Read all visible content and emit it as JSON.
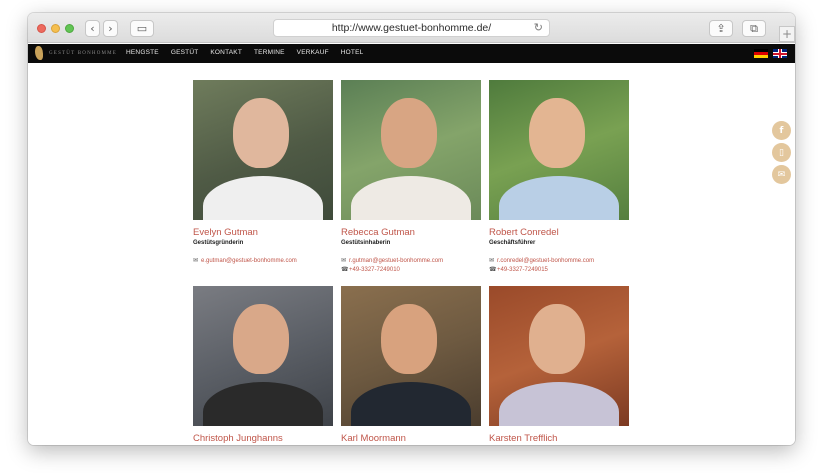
{
  "browser": {
    "url": "http://www.gestuet-bonhomme.de/",
    "back_icon": "‹",
    "forward_icon": "›",
    "sidebar_icon": "▭",
    "reload_icon": "↻",
    "share_icon": "⇪",
    "tabs_icon": "⧉",
    "new_tab_icon": "+"
  },
  "site": {
    "logo_text": "GESTÜT BONHOMME",
    "nav": [
      "HENGSTE",
      "GESTÜT",
      "KONTAKT",
      "TERMINE",
      "VERKAUF",
      "HOTEL"
    ]
  },
  "people": [
    {
      "name": "Evelyn Gutman",
      "role": "Gestütsgründerin",
      "email": "e.gutman@gestuet-bonhomme.com",
      "phone": ""
    },
    {
      "name": "Rebecca Gutman",
      "role": "Gestütsinhaberin",
      "email": "r.gutman@gestuet-bonhomme.com",
      "phone": "+49-3327-7249010"
    },
    {
      "name": "Robert Conredel",
      "role": "Geschäftsführer",
      "email": "r.conredel@gestuet-bonhomme.com",
      "phone": "+49-3327-7249015"
    },
    {
      "name": "Christoph Junghanns",
      "role": "",
      "email": "",
      "phone": ""
    },
    {
      "name": "Karl Moormann",
      "role": "",
      "email": "",
      "phone": ""
    },
    {
      "name": "Karsten Trefflich",
      "role": "",
      "email": "",
      "phone": ""
    }
  ],
  "social": {
    "facebook_icon": "f",
    "mobile_icon": "▯",
    "mail_icon": "✉"
  },
  "colors": {
    "accent": "#c0564a",
    "social": "#e3c79d",
    "nav_bg": "#0b0b0b"
  }
}
